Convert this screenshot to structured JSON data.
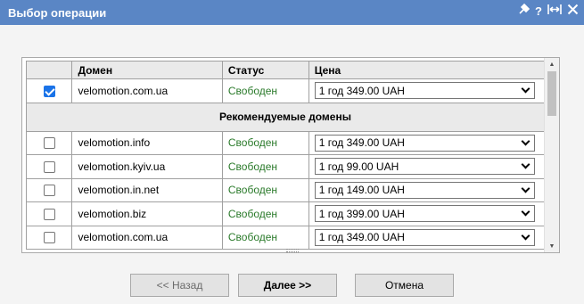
{
  "window": {
    "title": "Выбор операции"
  },
  "table": {
    "headers": {
      "domain": "Домен",
      "status": "Статус",
      "price": "Цена"
    },
    "top_row": {
      "checked": true,
      "domain": "velomotion.com.ua",
      "status": "Свободен",
      "price": "1 год 349.00 UAH"
    },
    "section_title": "Рекомендуемые домены",
    "rows": [
      {
        "checked": false,
        "domain": "velomotion.info",
        "status": "Свободен",
        "price": "1 год 349.00 UAH"
      },
      {
        "checked": false,
        "domain": "velomotion.kyiv.ua",
        "status": "Свободен",
        "price": "1 год 99.00 UAH"
      },
      {
        "checked": false,
        "domain": "velomotion.in.net",
        "status": "Свободен",
        "price": "1 год 149.00 UAH"
      },
      {
        "checked": false,
        "domain": "velomotion.biz",
        "status": "Свободен",
        "price": "1 год 399.00 UAH"
      },
      {
        "checked": false,
        "domain": "velomotion.com.ua",
        "status": "Свободен",
        "price": "1 год 349.00 UAH"
      }
    ]
  },
  "buttons": {
    "back": "<< Назад",
    "next": "Далее >>",
    "cancel": "Отмена"
  },
  "icons": [
    "pin-icon",
    "help-icon",
    "maximize-icon",
    "close-icon"
  ]
}
